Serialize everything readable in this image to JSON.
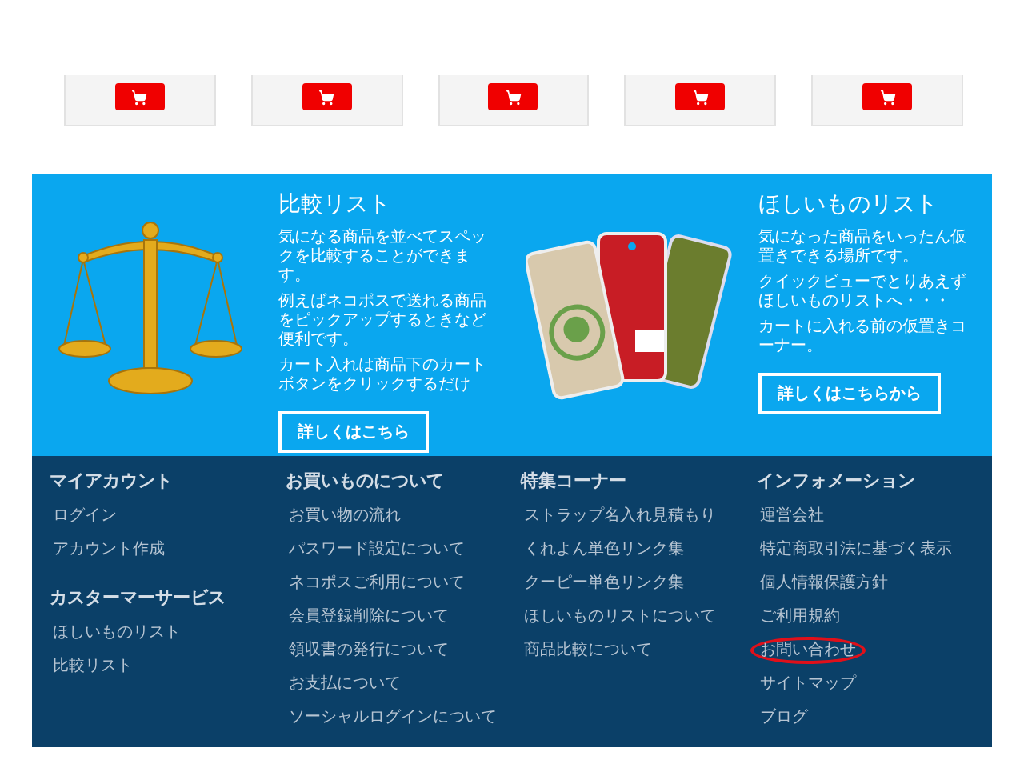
{
  "products": [
    {
      "cart_button": true
    },
    {
      "cart_button": true
    },
    {
      "cart_button": true
    },
    {
      "cart_button": true
    },
    {
      "cart_button": true
    }
  ],
  "promo": [
    {
      "kind": "scale",
      "title": "比較リスト",
      "paragraphs": [
        "気になる商品を並べてスペックを比較することができます。",
        "例えばネコポスで送れる商品をピックアップするときなど便利です。",
        "カート入れは商品下のカートボタンをクリックするだけ"
      ],
      "button": "詳しくはこちら"
    },
    {
      "kind": "tags",
      "title": "ほしいものリスト",
      "paragraphs": [
        "気になった商品をいったん仮置きできる場所です。",
        "クイックビューでとりあえずほしいものリストへ・・・",
        "カートに入れる前の仮置きコーナー。"
      ],
      "button": "詳しくはこちらから"
    }
  ],
  "footer": {
    "columns": [
      {
        "groups": [
          {
            "heading": "マイアカウント",
            "links": [
              {
                "label": "ログイン",
                "circled": false
              },
              {
                "label": "アカウント作成",
                "circled": false
              }
            ]
          },
          {
            "heading": "カスターマーサービス",
            "links": [
              {
                "label": "ほしいものリスト",
                "circled": false
              },
              {
                "label": "比較リスト",
                "circled": false
              }
            ]
          }
        ]
      },
      {
        "groups": [
          {
            "heading": "お買いものについて",
            "links": [
              {
                "label": "お買い物の流れ",
                "circled": false
              },
              {
                "label": "パスワード設定について",
                "circled": false
              },
              {
                "label": "ネコポスご利用について",
                "circled": false
              },
              {
                "label": "会員登録削除について",
                "circled": false
              },
              {
                "label": "領収書の発行について",
                "circled": false
              },
              {
                "label": "お支払について",
                "circled": false
              },
              {
                "label": "ソーシャルログインについて",
                "circled": false
              }
            ]
          }
        ]
      },
      {
        "groups": [
          {
            "heading": "特集コーナー",
            "links": [
              {
                "label": "ストラップ名入れ見積もり",
                "circled": false
              },
              {
                "label": "くれよん単色リンク集",
                "circled": false
              },
              {
                "label": "クーピー単色リンク集",
                "circled": false
              },
              {
                "label": "ほしいものリストについて",
                "circled": false
              },
              {
                "label": "商品比較について",
                "circled": false
              }
            ]
          }
        ]
      },
      {
        "groups": [
          {
            "heading": "インフォメーション",
            "links": [
              {
                "label": "運営会社",
                "circled": false
              },
              {
                "label": "特定商取引法に基づく表示",
                "circled": false
              },
              {
                "label": "個人情報保護方針",
                "circled": false
              },
              {
                "label": "ご利用規約",
                "circled": false
              },
              {
                "label": "お問い合わせ",
                "circled": true
              },
              {
                "label": "サイトマップ",
                "circled": false
              },
              {
                "label": "ブログ",
                "circled": false
              }
            ]
          }
        ]
      }
    ]
  }
}
